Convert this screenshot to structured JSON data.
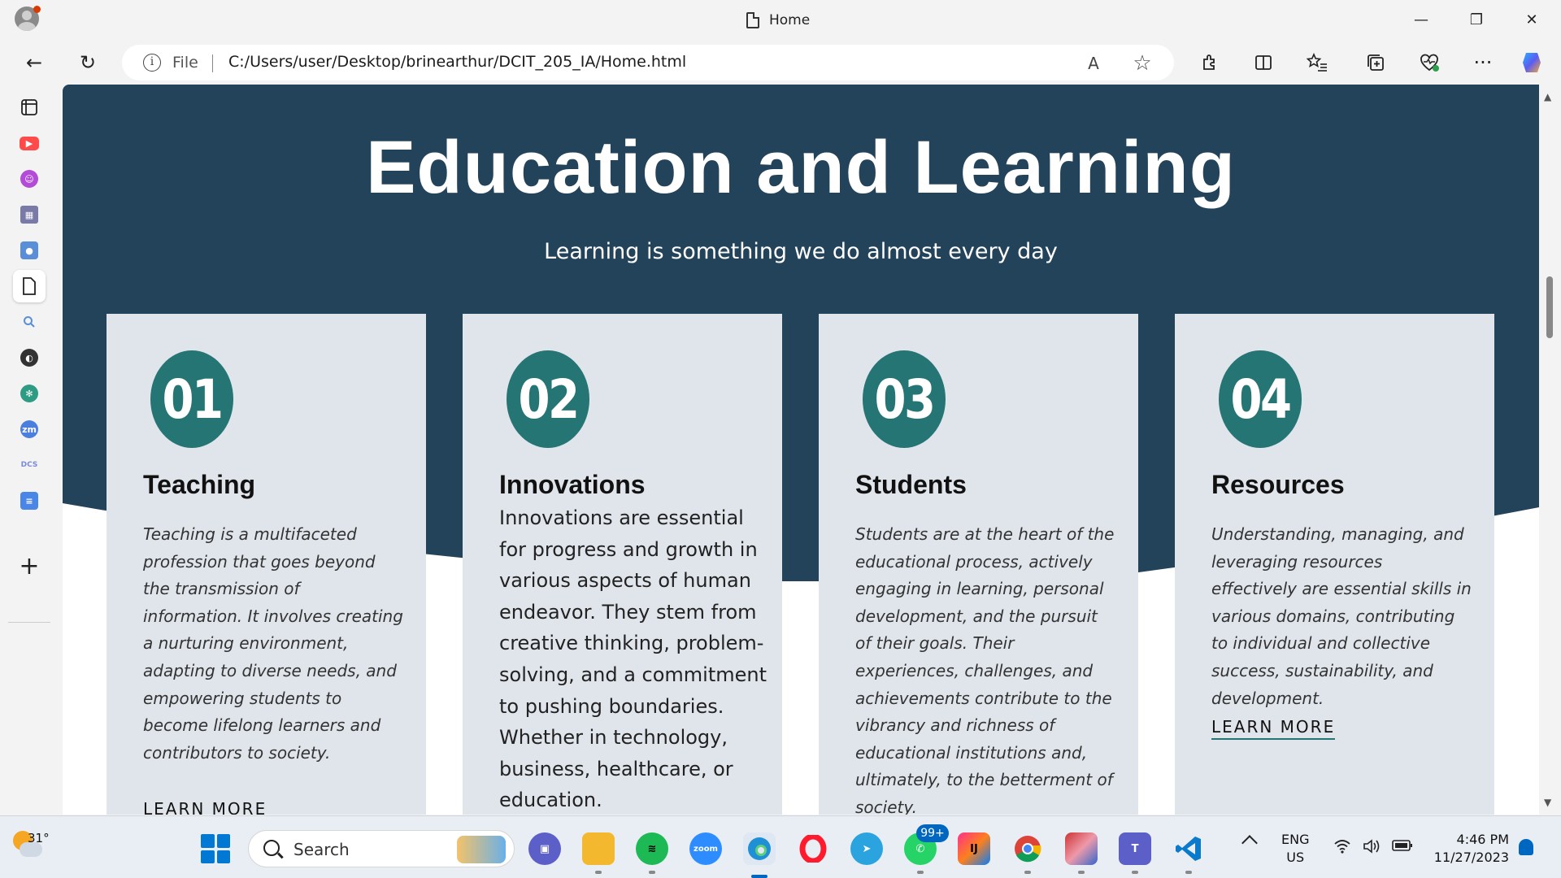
{
  "window": {
    "tab_title": "Home",
    "minimize": "—",
    "restore": "❐",
    "close": "✕"
  },
  "toolbar": {
    "back": "←",
    "reload": "↻",
    "scheme_label": "File",
    "url": "C:/Users/user/Desktop/brinearthur/DCIT_205_IA/Home.html",
    "read_aloud": "A",
    "favorite": "☆",
    "more": "···"
  },
  "page": {
    "title": "Education and Learning",
    "subtitle": "Learning is something we do almost every day",
    "cards": [
      {
        "number": "01",
        "title": "Teaching",
        "description": "Teaching is a multifaceted profession that goes beyond the transmission of information. It involves creating a nurturing environment, adapting to diverse needs, and empowering students to become lifelong learners and contributors to society.",
        "link": "LEARN MORE"
      },
      {
        "number": "02",
        "title": "Innovations",
        "description": "Innovations are essential for progress and growth in various aspects of human endeavor. They stem from creative thinking, problem-solving, and a commitment to pushing boundaries. Whether in technology, business, healthcare, or education."
      },
      {
        "number": "03",
        "title": "Students",
        "description": "Students are at the heart of the educational process, actively engaging in learning, personal development, and the pursuit of their goals. Their experiences, challenges, and achievements contribute to the vibrancy and richness of educational institutions and, ultimately, to the betterment of society."
      },
      {
        "number": "04",
        "title": "Resources",
        "description": "Understanding, managing, and leveraging resources effectively are essential skills in various domains, contributing to individual and collective success, sustainability, and development.",
        "link": "LEARN MORE"
      }
    ]
  },
  "sidebar": {
    "items": [
      "tab-actions-icon",
      "youtube-icon",
      "chat-bot-icon",
      "building-icon",
      "contacts-icon",
      "document-icon",
      "search-icon",
      "github-icon",
      "chatgpt-icon",
      "zoom-icon",
      "dcs-icon",
      "notes-icon"
    ],
    "zoom_label": "zm",
    "dcs_label": "DCS",
    "add": "+"
  },
  "taskbar": {
    "temperature": "31°",
    "search_label": "Search",
    "zoom_label": "zoom",
    "whatsapp_badge": "99+",
    "language": "ENG",
    "region": "US",
    "time": "4:46 PM",
    "date": "11/27/2023"
  },
  "colors": {
    "hero_bg": "#23435a",
    "card_bg": "#e0e5ec",
    "accent_teal": "#257574"
  }
}
